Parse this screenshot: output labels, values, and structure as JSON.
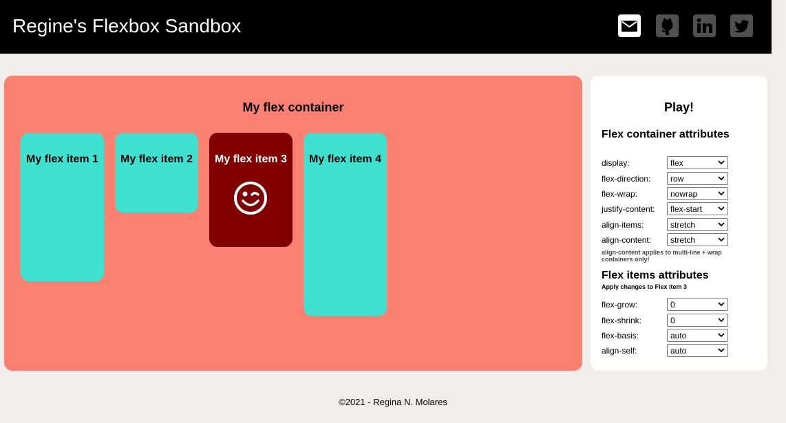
{
  "header": {
    "title": "Regine's Flexbox Sandbox",
    "social_icons": [
      "email-icon",
      "github-icon",
      "linkedin-icon",
      "twitter-icon"
    ]
  },
  "colors": {
    "header_bg": "#000000",
    "page_bg": "#f0edeb",
    "container_bg": "#fa8072",
    "item_bg": "#40e0d0",
    "selected_item_bg": "#800000",
    "panel_bg": "#ffffff"
  },
  "sandbox": {
    "title": "My flex container",
    "items": [
      {
        "label": "My flex item 1"
      },
      {
        "label": "My flex item 2"
      },
      {
        "label": "My flex item 3",
        "icon": "winking-face-icon"
      },
      {
        "label": "My flex item 4"
      }
    ]
  },
  "panel": {
    "title": "Play!",
    "container_heading": "Flex container attributes",
    "container_attributes": [
      {
        "label": "display:",
        "value": "flex"
      },
      {
        "label": "flex-direction:",
        "value": "row"
      },
      {
        "label": "flex-wrap:",
        "value": "nowrap"
      },
      {
        "label": "justify-content:",
        "value": "flex-start"
      },
      {
        "label": "align-items:",
        "value": "stretch"
      },
      {
        "label": "align-content:",
        "value": "stretch"
      }
    ],
    "align_content_note": "align-content applies to multi-line + wrap containers only!",
    "items_heading": "Flex items attributes",
    "items_subnote": "Apply changes to Flex item 3",
    "item_attributes": [
      {
        "label": "flex-grow:",
        "value": "0"
      },
      {
        "label": "flex-shrink:",
        "value": "0"
      },
      {
        "label": "flex-basis:",
        "value": "auto"
      },
      {
        "label": "align-self:",
        "value": "auto"
      }
    ]
  },
  "footer": {
    "text": "©2021 - Regina N. Molares"
  }
}
